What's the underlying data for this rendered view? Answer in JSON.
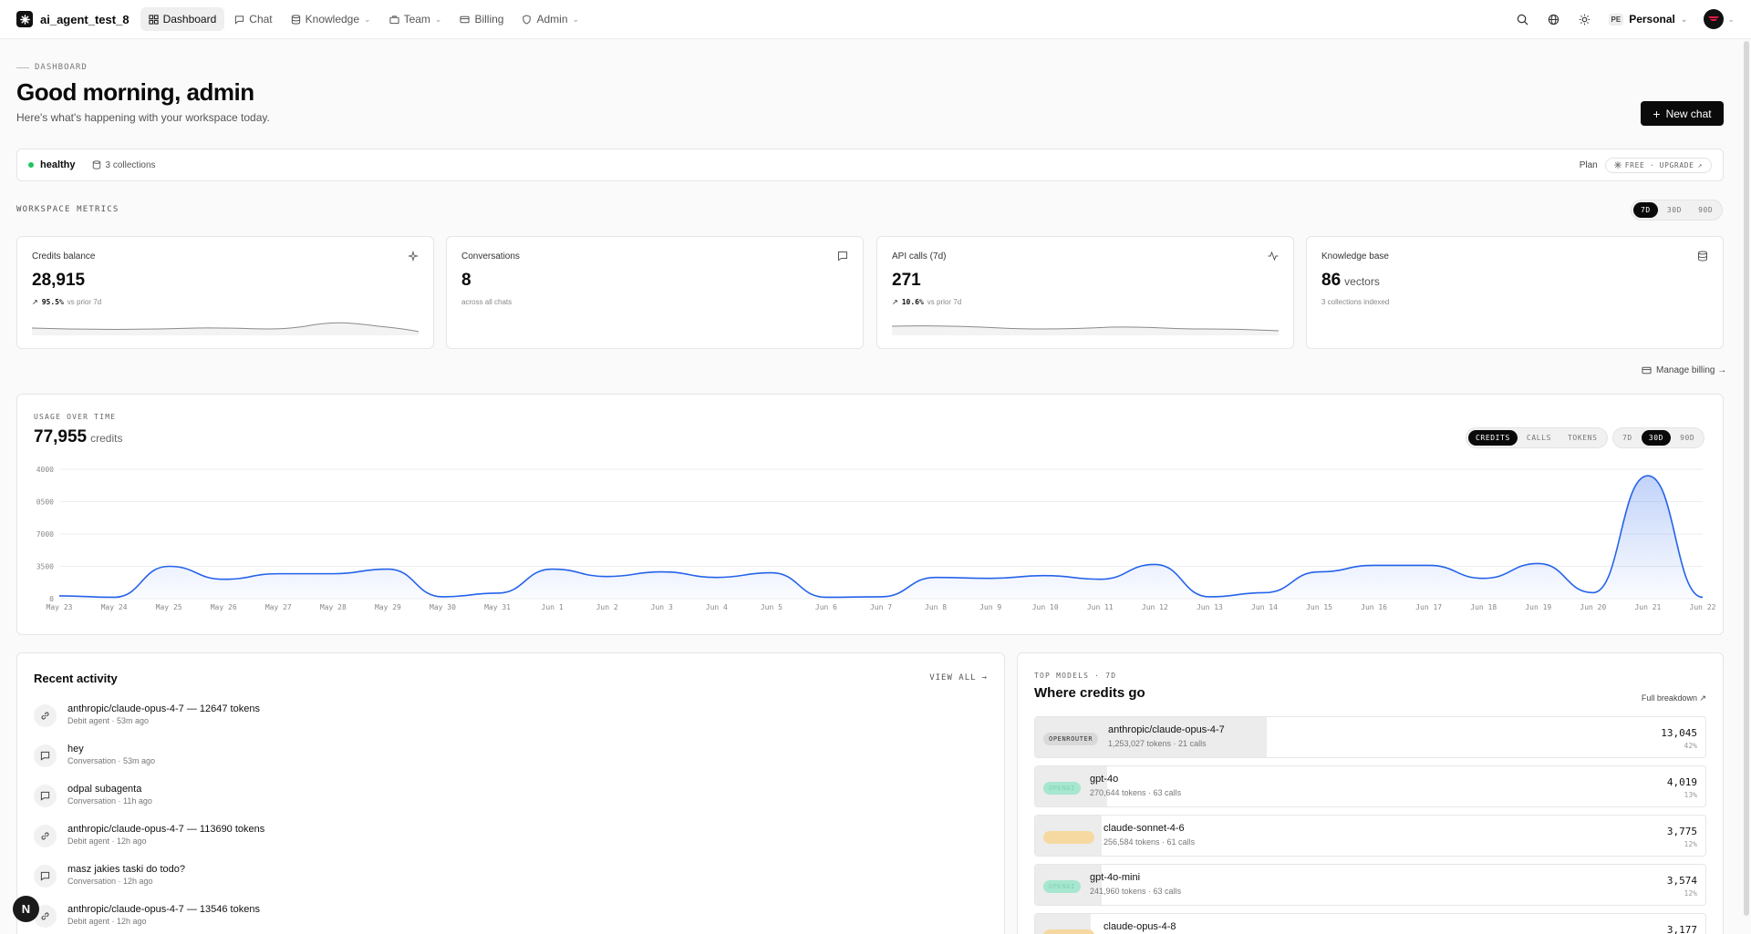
{
  "app": {
    "name": "ai_agent_test_8"
  },
  "nav": {
    "items": [
      {
        "label": "Dashboard",
        "icon": "grid-icon",
        "active": true
      },
      {
        "label": "Chat",
        "icon": "chat-icon"
      },
      {
        "label": "Knowledge",
        "icon": "database-icon",
        "dropdown": true
      },
      {
        "label": "Team",
        "icon": "briefcase-icon",
        "dropdown": true
      },
      {
        "label": "Billing",
        "icon": "card-icon"
      },
      {
        "label": "Admin",
        "icon": "shield-icon",
        "dropdown": true
      }
    ],
    "workspace_badge": "PE",
    "workspace_name": "Personal"
  },
  "header": {
    "breadcrumb": "DASHBOARD",
    "greeting": "Good morning, admin",
    "subtitle": "Here's what's happening with your workspace today.",
    "new_chat": "New chat"
  },
  "status": {
    "health": "healthy",
    "collections": "3 collections",
    "plan_label": "Plan",
    "plan_value": "FREE · UPGRADE"
  },
  "metrics": {
    "label": "WORKSPACE METRICS",
    "ranges": [
      "7D",
      "30D",
      "90D"
    ],
    "active_range": "7D",
    "cards": [
      {
        "title": "Credits balance",
        "value": "28,915",
        "unit": "",
        "delta": "95.5%",
        "sub": "vs prior 7d",
        "icon": "sparkle-icon"
      },
      {
        "title": "Conversations",
        "value": "8",
        "unit": "",
        "delta": "",
        "sub": "across all chats",
        "icon": "message-icon"
      },
      {
        "title": "API calls (7d)",
        "value": "271",
        "unit": "",
        "delta": "10.6%",
        "sub": "vs prior 7d",
        "icon": "activity-icon"
      },
      {
        "title": "Knowledge base",
        "value": "86",
        "unit": "vectors",
        "delta": "",
        "sub": "3 collections indexed",
        "icon": "database-icon"
      }
    ]
  },
  "billing_link": "Manage billing →",
  "usage": {
    "label": "USAGE OVER TIME",
    "total": "77,955",
    "unit": "credits",
    "metric_tabs": [
      "CREDITS",
      "CALLS",
      "TOKENS"
    ],
    "active_metric": "CREDITS",
    "range_tabs": [
      "7D",
      "30D",
      "90D"
    ],
    "active_range": "30D"
  },
  "chart_data": {
    "type": "area",
    "x": [
      "May 23",
      "May 24",
      "May 25",
      "May 26",
      "May 27",
      "May 28",
      "May 29",
      "May 30",
      "May 31",
      "Jun 1",
      "Jun 2",
      "Jun 3",
      "Jun 4",
      "Jun 5",
      "Jun 6",
      "Jun 7",
      "Jun 8",
      "Jun 9",
      "Jun 10",
      "Jun 11",
      "Jun 12",
      "Jun 13",
      "Jun 14",
      "Jun 15",
      "Jun 16",
      "Jun 17",
      "Jun 18",
      "Jun 19",
      "Jun 20",
      "Jun 21",
      "Jun 22"
    ],
    "values": [
      300,
      150,
      3500,
      2100,
      2700,
      2700,
      3200,
      200,
      600,
      3200,
      2400,
      2900,
      2300,
      2800,
      150,
      200,
      2300,
      2200,
      2500,
      2100,
      3700,
      200,
      650,
      2900,
      3600,
      3600,
      2200,
      3800,
      650,
      13300,
      150
    ],
    "yticks": [
      "0",
      "3500",
      "7000",
      "0500",
      "4000"
    ],
    "ylim": [
      0,
      14000
    ],
    "grid": true,
    "color": "#2563eb"
  },
  "activity": {
    "title": "Recent activity",
    "view_all": "VIEW ALL",
    "items": [
      {
        "title": "anthropic/claude-opus-4-7 — 12647 tokens",
        "sub": "Debit agent · 53m ago",
        "icon": "link-icon"
      },
      {
        "title": "hey",
        "sub": "Conversation · 53m ago",
        "icon": "message-icon"
      },
      {
        "title": "odpal subagenta",
        "sub": "Conversation · 11h ago",
        "icon": "message-icon"
      },
      {
        "title": "anthropic/claude-opus-4-7 — 113690 tokens",
        "sub": "Debit agent · 12h ago",
        "icon": "link-icon"
      },
      {
        "title": "masz jakies taski do todo?",
        "sub": "Conversation · 12h ago",
        "icon": "message-icon"
      },
      {
        "title": "anthropic/claude-opus-4-7 — 13546 tokens",
        "sub": "Debit agent · 12h ago",
        "icon": "link-icon"
      }
    ]
  },
  "models": {
    "label": "TOP MODELS · 7D",
    "title": "Where credits go",
    "full_breakdown": "Full breakdown ↗",
    "items": [
      {
        "tag": "OPENROUTER",
        "tag_color": "#d9d9d9",
        "tag_text": "#333",
        "name": "anthropic/claude-opus-4-7",
        "sub": "1,253,027 tokens · 21 calls",
        "value": "13,045",
        "pct": "42%",
        "share": 0.42
      },
      {
        "tag": "OPENAI",
        "tag_color": "#a7e6cf",
        "tag_text": "#7fd3b5",
        "name": "gpt-4o",
        "sub": "270,644 tokens · 63 calls",
        "value": "4,019",
        "pct": "13%",
        "share": 0.13
      },
      {
        "tag": "",
        "tag_color": "#f6d9a0",
        "tag_text": "#f6d9a0",
        "name": "claude-sonnet-4-6",
        "sub": "256,584 tokens · 61 calls",
        "value": "3,775",
        "pct": "12%",
        "share": 0.12
      },
      {
        "tag": "OPENAI",
        "tag_color": "#a7e6cf",
        "tag_text": "#7fd3b5",
        "name": "gpt-4o-mini",
        "sub": "241,960 tokens · 63 calls",
        "value": "3,574",
        "pct": "12%",
        "share": 0.12
      },
      {
        "tag": "",
        "tag_color": "#f6d9a0",
        "tag_text": "#f6d9a0",
        "name": "claude-opus-4-8",
        "sub": "",
        "value": "3,177",
        "pct": "",
        "share": 0.1
      }
    ]
  },
  "fab_letter": "N"
}
